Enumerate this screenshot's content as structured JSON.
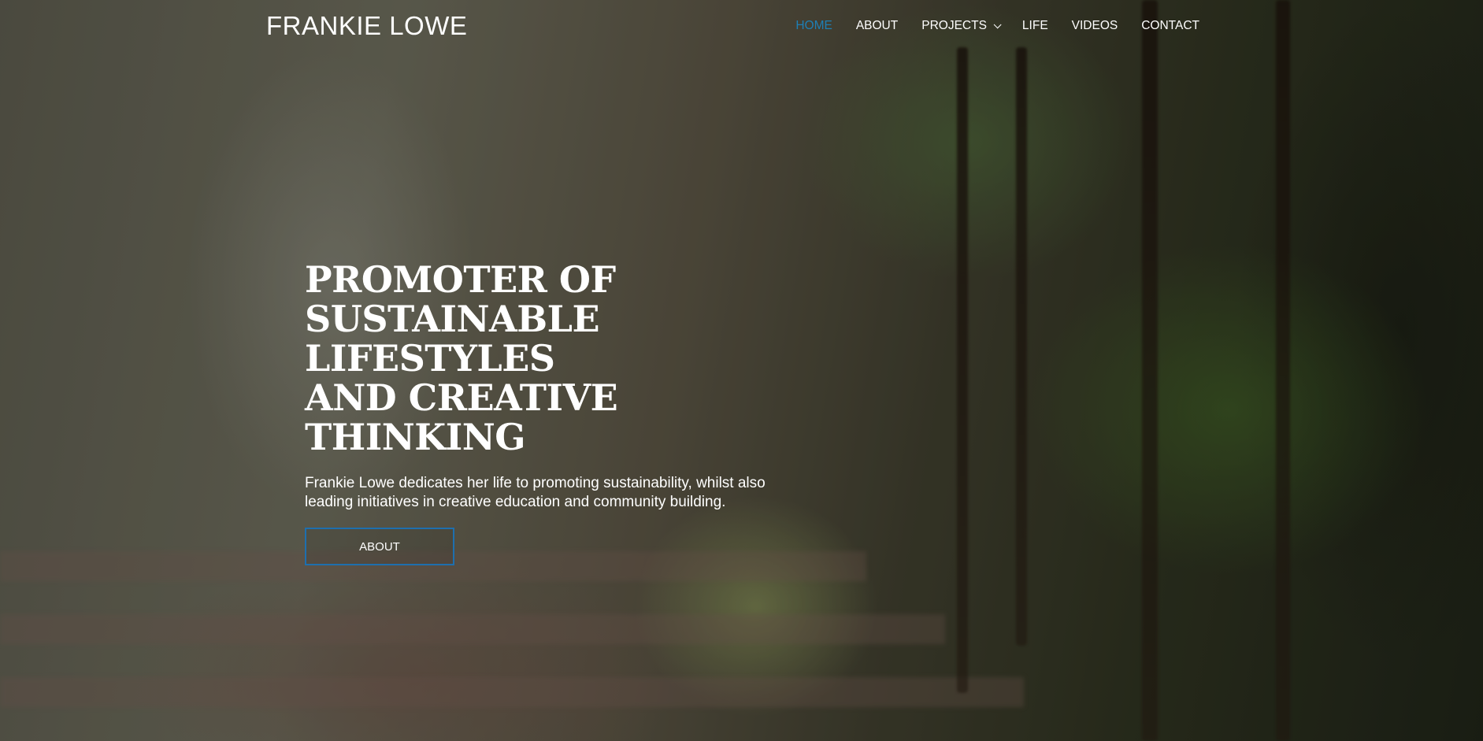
{
  "site": {
    "logo": "FRANKIE LOWE"
  },
  "nav": {
    "items": [
      {
        "label": "HOME",
        "active": true
      },
      {
        "label": "ABOUT",
        "active": false
      },
      {
        "label": "PROJECTS",
        "active": false,
        "has_dropdown": true
      },
      {
        "label": "LIFE",
        "active": false
      },
      {
        "label": "VIDEOS",
        "active": false
      },
      {
        "label": "CONTACT",
        "active": false
      }
    ],
    "active_color": "#1e7fb5"
  },
  "hero": {
    "title_line_1": "PROMOTER OF",
    "title_line_2": "SUSTAINABLE LIFESTYLES",
    "title_line_3": "AND CREATIVE THINKING",
    "subtitle": "Frankie Lowe dedicates her life to promoting sustainability, whilst also leading initiatives in creative education and community building.",
    "button_label": "ABOUT",
    "button_border_color": "#1e6fae"
  }
}
